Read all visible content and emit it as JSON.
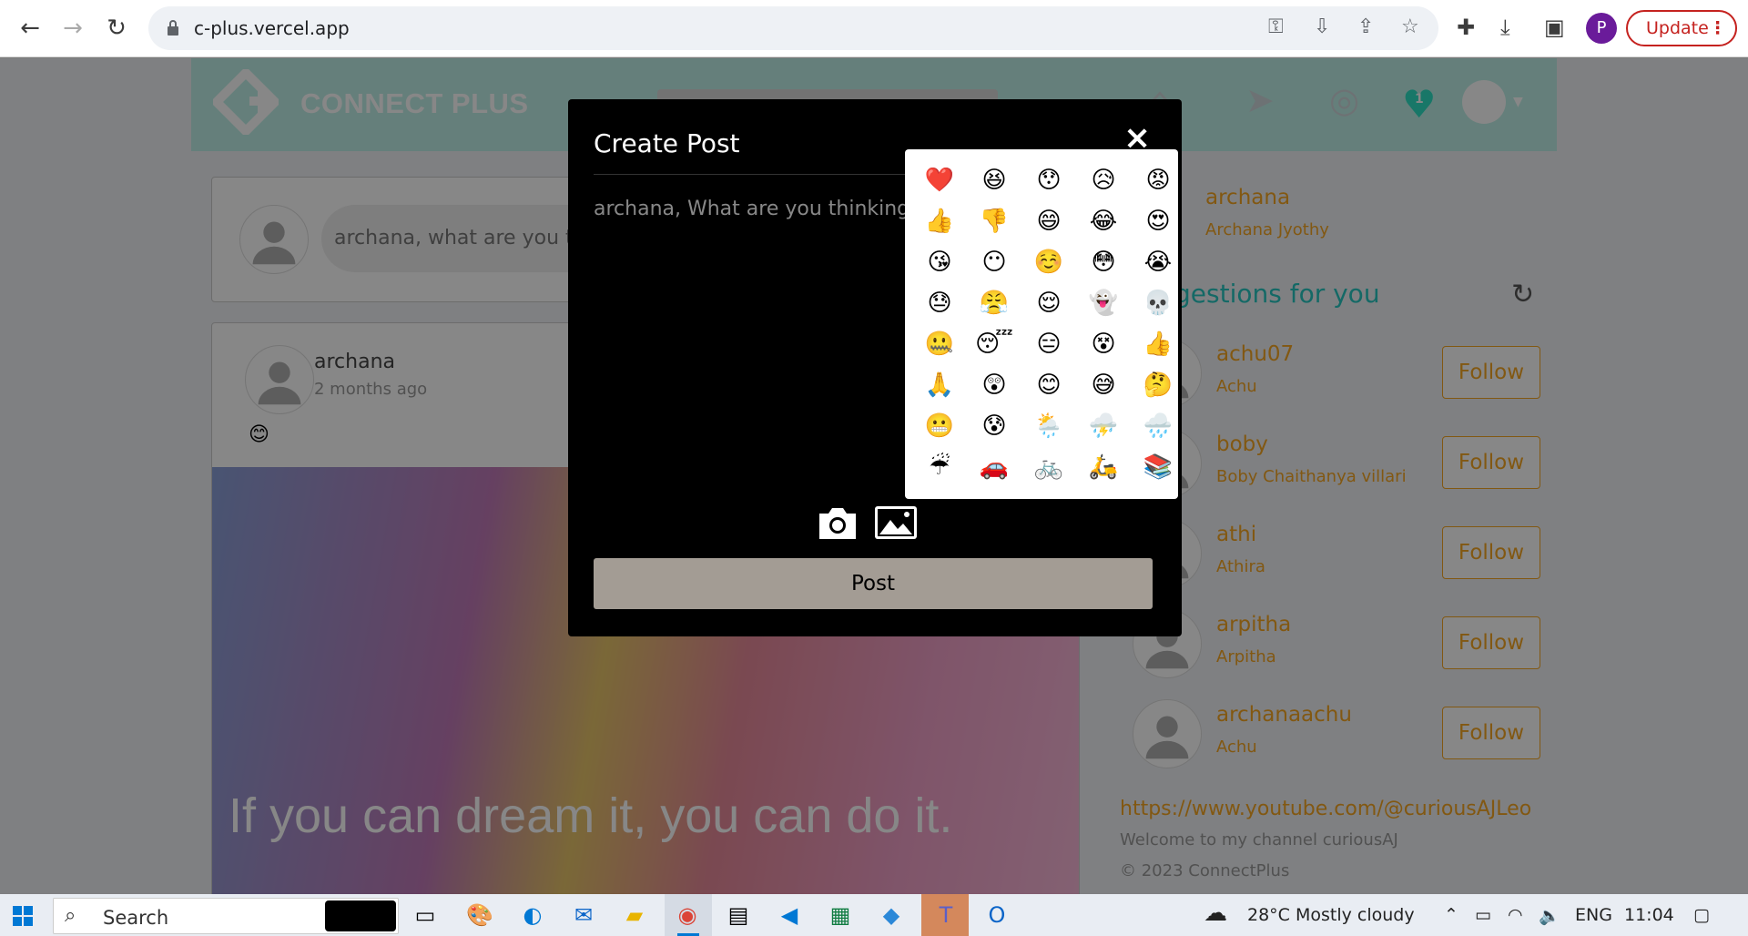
{
  "browser": {
    "url": "c-plus.vercel.app",
    "profile_initial": "P",
    "update_label": "Update"
  },
  "app": {
    "brand": "CONNECT PLUS",
    "notification_count": "1",
    "composer_placeholder": "archana, what are you th",
    "post": {
      "username": "archana",
      "time": "2 months ago",
      "emoji": "😊",
      "image_quote": "If you can dream it, you can do it."
    },
    "sidebar": {
      "me_username": "archana",
      "me_fullname": "Archana Jyothy",
      "suggestions_title": "gestions for you",
      "follow_label": "Follow",
      "suggestions": [
        {
          "username": "achu07",
          "fullname": "Achu"
        },
        {
          "username": "boby",
          "fullname": "Boby Chaithanya villari"
        },
        {
          "username": "athi",
          "fullname": "Athira"
        },
        {
          "username": "arpitha",
          "fullname": "Arpitha"
        },
        {
          "username": "archanaachu",
          "fullname": "Achu"
        }
      ],
      "youtube_link": "https://www.youtube.com/@curiousAJLeo",
      "welcome": "Welcome to my channel curiousAJ",
      "copyright": "© 2023 ConnectPlus"
    }
  },
  "modal": {
    "title": "Create Post",
    "close": "×",
    "placeholder": "archana, What are you thinking?",
    "post_label": "Post",
    "emojis": [
      "❤️",
      "😆",
      "😯",
      "😥",
      "😡",
      "👍",
      "👎",
      "😄",
      "😂",
      "😍",
      "😘",
      "😶",
      "☺️",
      "😳",
      "😭",
      "😓",
      "😤",
      "😌",
      "👻",
      "💀",
      "🤐",
      "😴",
      "😑",
      "😵",
      "👍",
      "🙏",
      "😲",
      "😊",
      "😅",
      "🤔",
      "😬",
      "😰",
      "🌦️",
      "⛈️",
      "🌧️",
      "☔",
      "🚗",
      "🚲",
      "🛵",
      "📚"
    ]
  },
  "taskbar": {
    "search_label": "Search",
    "weather": "28°C  Mostly cloudy",
    "language": "ENG",
    "time": "11:04"
  },
  "colors": {
    "brand_teal": "#bff0e8",
    "accent_orange": "#f5a623",
    "suggest_title": "#27c7c0",
    "post_button": "#a39c94"
  }
}
